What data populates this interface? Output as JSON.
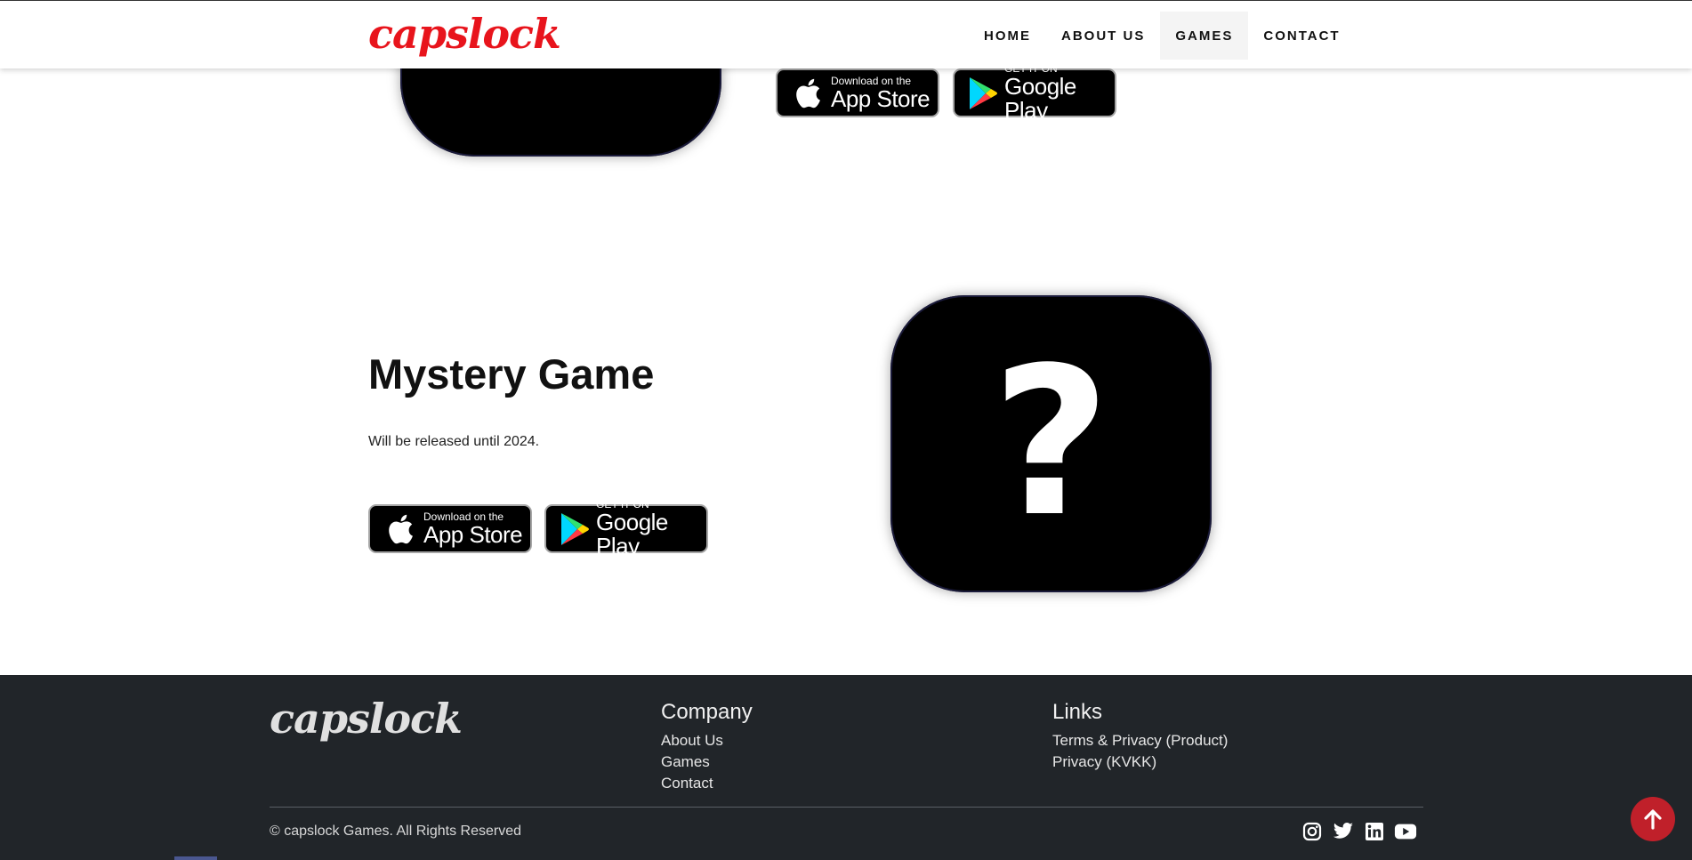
{
  "nav": {
    "logo": "capslock",
    "items": [
      {
        "label": "HOME"
      },
      {
        "label": "ABOUT US"
      },
      {
        "label": "GAMES"
      },
      {
        "label": "CONTACT"
      }
    ],
    "active": "GAMES"
  },
  "store_buttons": {
    "appstore_small": "Download on the",
    "appstore_big": "App Store",
    "googleplay_small": "GET IT ON",
    "googleplay_big": "Google Play"
  },
  "game": {
    "title": "Mystery Game",
    "description": "Will be released until 2024.",
    "icon_symbol": "?"
  },
  "footer": {
    "logo": "capslock",
    "company": {
      "heading": "Company",
      "links": [
        "About Us",
        "Games",
        "Contact"
      ]
    },
    "links": {
      "heading": "Links",
      "links": [
        "Terms & Privacy (Product)",
        "Privacy (KVKK)"
      ]
    },
    "copyright": "© capslock Games. All Rights Reserved",
    "socials": [
      "instagram-icon",
      "twitter-icon",
      "linkedin-icon",
      "youtube-icon"
    ]
  },
  "colors": {
    "brand_red": "#e8141c",
    "footer_bg": "#212529",
    "scroll_top": "#c0202a"
  }
}
